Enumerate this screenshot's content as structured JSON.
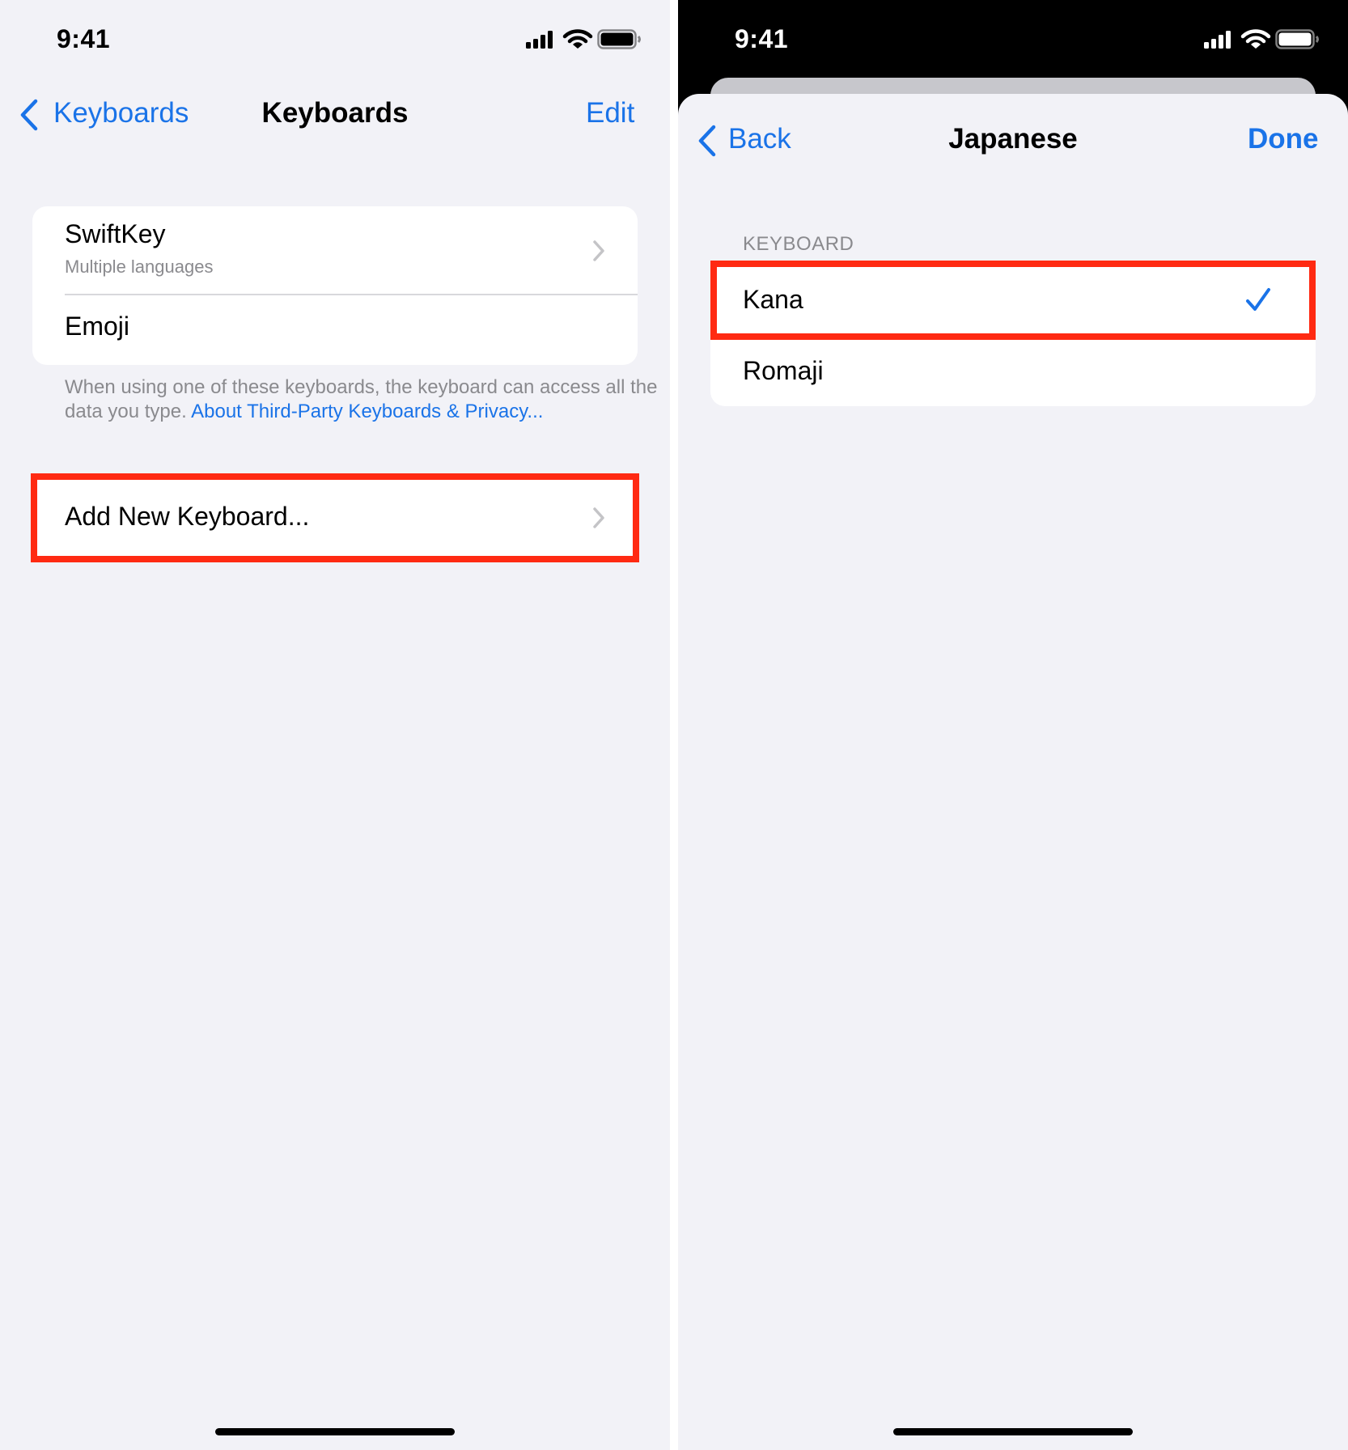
{
  "left": {
    "status": {
      "time": "9:41"
    },
    "nav": {
      "back_label": "Keyboards",
      "title": "Keyboards",
      "edit_label": "Edit"
    },
    "keyboards": [
      {
        "name": "SwiftKey",
        "subtitle": "Multiple languages"
      },
      {
        "name": "Emoji"
      }
    ],
    "footer": {
      "text": "When using one of these keyboards, the keyboard can access all the data you type.",
      "link": "About Third-Party Keyboards & Privacy..."
    },
    "add_keyboard_label": "Add New Keyboard..."
  },
  "right": {
    "status": {
      "time": "9:41"
    },
    "nav": {
      "back_label": "Back",
      "title": "Japanese",
      "done_label": "Done"
    },
    "section_header": "KEYBOARD",
    "options": [
      {
        "label": "Kana",
        "selected": true
      },
      {
        "label": "Romaji",
        "selected": false
      }
    ]
  },
  "colors": {
    "accent": "#1a73e8",
    "highlight": "#ff2a12",
    "background": "#f2f2f7",
    "dark_status_bar": "#000000"
  },
  "icons": [
    "chevron-left-icon",
    "chevron-right-icon",
    "checkmark-icon",
    "cellular-signal-icon",
    "wifi-icon",
    "battery-icon"
  ]
}
